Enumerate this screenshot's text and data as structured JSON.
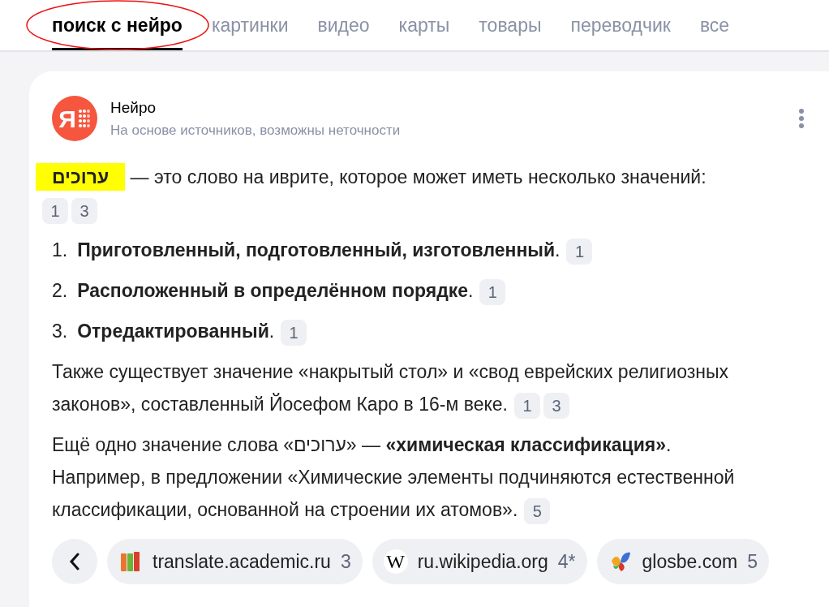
{
  "tabs": [
    {
      "label": "поиск с нейро",
      "selected": true,
      "circled": true
    },
    {
      "label": "картинки",
      "selected": false,
      "circled": false
    },
    {
      "label": "видео",
      "selected": false,
      "circled": false
    },
    {
      "label": "карты",
      "selected": false,
      "circled": false
    },
    {
      "label": "товары",
      "selected": false,
      "circled": false
    },
    {
      "label": "переводчик",
      "selected": false,
      "circled": false
    },
    {
      "label": "все",
      "selected": false,
      "circled": false
    }
  ],
  "answer": {
    "logo_letter": "Я",
    "title": "Нейро",
    "subtitle": "На основе источников, возможны неточности",
    "paragraphs": [
      {
        "kind": "intro",
        "term": "ערוכים",
        "text": "— это слово на иврите, которое может иметь несколько значений:",
        "refs": [
          "1",
          "3"
        ]
      },
      {
        "kind": "numbered",
        "number": "1.",
        "text": "**Приготовленный, подготовленный, изготовленный**.",
        "refs": [
          "1"
        ]
      },
      {
        "kind": "numbered",
        "number": "2.",
        "text": "**Расположенный в определённом порядке**.",
        "refs": [
          "1"
        ]
      },
      {
        "kind": "numbered",
        "number": "3.",
        "text": "**Отредактированный**.",
        "refs": [
          "1"
        ]
      },
      {
        "kind": "text",
        "text": "Также существует значение «накрытый стол» и «свод еврейских религиозных законов», составленный Йосефом Каро в 16-м веке.",
        "refs": [
          "1",
          "3"
        ]
      },
      {
        "kind": "text",
        "text": "Ещё одно значение слова «ערוכים» — **«химическая классификация»**. Например, в предложении «Химические элементы подчиняются естественной классификации, основанной на строении их атомов».",
        "refs": [
          "5"
        ]
      }
    ],
    "sources": [
      {
        "kind": "books",
        "site": "translate.academic.ru",
        "count": "3"
      },
      {
        "kind": "letter",
        "letter": "W",
        "site": "ru.wikipedia.org",
        "count": "4*"
      },
      {
        "kind": "bird",
        "site": "glosbe.com",
        "count": "5"
      }
    ]
  }
}
